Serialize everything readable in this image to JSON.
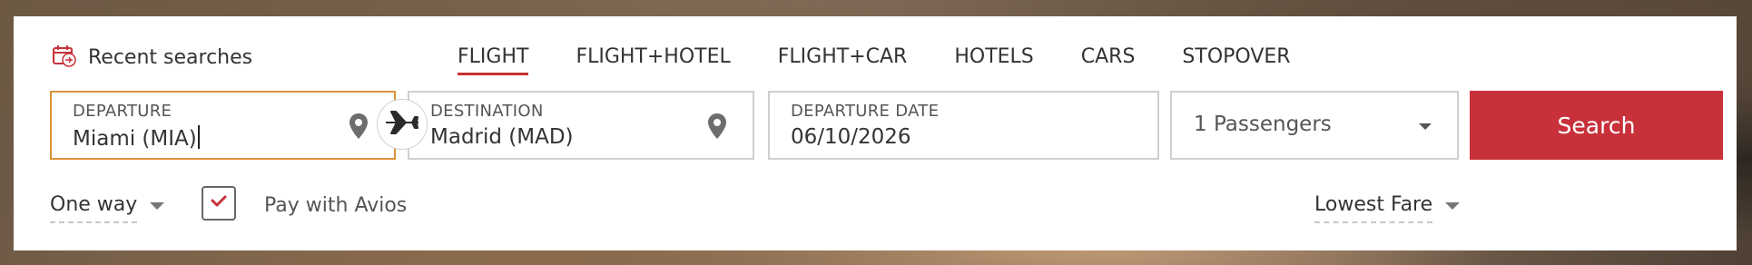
{
  "recent_searches": {
    "label": "Recent searches",
    "icon": "calendar-plane-icon"
  },
  "tabs": [
    {
      "label": "FLIGHT",
      "active": true
    },
    {
      "label": "FLIGHT+HOTEL",
      "active": false
    },
    {
      "label": "FLIGHT+CAR",
      "active": false
    },
    {
      "label": "HOTELS",
      "active": false
    },
    {
      "label": "CARS",
      "active": false
    },
    {
      "label": "STOPOVER",
      "active": false
    }
  ],
  "departure": {
    "label": "DEPARTURE",
    "value": "Miami (MIA)"
  },
  "destination": {
    "label": "DESTINATION",
    "value": "Madrid (MAD)"
  },
  "departure_date": {
    "label": "DEPARTURE DATE",
    "value": "06/10/2026"
  },
  "passengers": {
    "value": "1 Passengers"
  },
  "search_button": {
    "label": "Search"
  },
  "trip_type": {
    "value": "One way"
  },
  "avios": {
    "label": "Pay with Avios",
    "checked": true
  },
  "fare": {
    "value": "Lowest Fare"
  },
  "colors": {
    "accent_red": "#c8313a",
    "focus_border": "#d9943a",
    "tab_underline": "#c8312f"
  }
}
